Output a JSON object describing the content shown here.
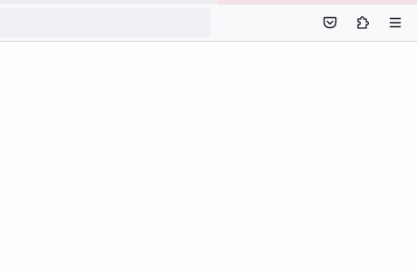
{
  "browser": {
    "tabstrip_color": "#f0edf2",
    "tab_accent_color": "#f3e1e7",
    "toolbar_color": "#f9f9fb",
    "urlbar": {
      "value": "",
      "placeholder": ""
    },
    "toolbar_buttons": [
      {
        "icon": "pocket-icon"
      },
      {
        "icon": "extensions-puzzle-icon"
      },
      {
        "icon": "hamburger-menu-icon"
      }
    ]
  },
  "page": {
    "background": "#ffffff"
  }
}
